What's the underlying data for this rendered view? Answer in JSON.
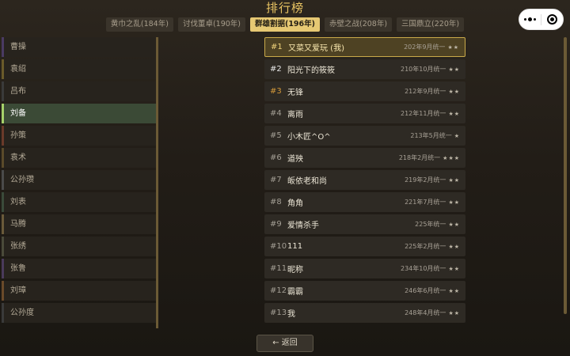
{
  "title": "排行榜",
  "tabs": [
    {
      "label": "黄巾之乱(184年)"
    },
    {
      "label": "讨伐董卓(190年)"
    },
    {
      "label": "群雄割据(196年)",
      "active": true
    },
    {
      "label": "赤壁之战(208年)"
    },
    {
      "label": "三国鼎立(220年)"
    }
  ],
  "sidebar": {
    "items": [
      {
        "label": "曹操",
        "accent": "#4a3a62"
      },
      {
        "label": "袁绍",
        "accent": "#6a5a2a"
      },
      {
        "label": "吕布",
        "accent": "#3a3a3a"
      },
      {
        "label": "刘备",
        "accent": "#a6d16a",
        "active": true
      },
      {
        "label": "孙策",
        "accent": "#6a3a2a"
      },
      {
        "label": "袁术",
        "accent": "#5a4a2a"
      },
      {
        "label": "公孙瓒",
        "accent": "#4a4a4a"
      },
      {
        "label": "刘表",
        "accent": "#3a4a3a"
      },
      {
        "label": "马腾",
        "accent": "#6a5a3a"
      },
      {
        "label": "张绣",
        "accent": "#4a4a3a"
      },
      {
        "label": "张鲁",
        "accent": "#4a3a5a"
      },
      {
        "label": "刘璋",
        "accent": "#6a4a2a"
      },
      {
        "label": "公孙度",
        "accent": "#3a3a3a"
      }
    ]
  },
  "ranking": [
    {
      "rank": "#1",
      "name": "又菜又爱玩 (我)",
      "date": "202年9月统一",
      "stars": "★★",
      "me": true,
      "medal": "gold"
    },
    {
      "rank": "#2",
      "name": "阳光下的筱筱",
      "date": "210年10月统一",
      "stars": "★★",
      "medal": "silver"
    },
    {
      "rank": "#3",
      "name": "无锋",
      "date": "212年9月统一",
      "stars": "★★",
      "medal": "bronze"
    },
    {
      "rank": "#4",
      "name": "离雨",
      "date": "212年11月统一",
      "stars": "★★"
    },
    {
      "rank": "#5",
      "name": "小木匠^O^",
      "date": "213年5月统一",
      "stars": "★"
    },
    {
      "rank": "#6",
      "name": "道殃",
      "date": "218年2月统一",
      "stars": "★★★"
    },
    {
      "rank": "#7",
      "name": "皈依老和尚",
      "date": "219年2月统一",
      "stars": "★★"
    },
    {
      "rank": "#8",
      "name": "角角",
      "date": "221年7月统一",
      "stars": "★★"
    },
    {
      "rank": "#9",
      "name": "爱情杀手",
      "date": "225年统一",
      "stars": "★★"
    },
    {
      "rank": "#10",
      "name": "111",
      "date": "225年2月统一",
      "stars": "★★"
    },
    {
      "rank": "#11",
      "name": "昵称",
      "date": "234年10月统一",
      "stars": "★★"
    },
    {
      "rank": "#12",
      "name": "霸霸",
      "date": "246年6月统一",
      "stars": "★★"
    },
    {
      "rank": "#13",
      "name": "我",
      "date": "248年4月统一",
      "stars": "★★"
    }
  ],
  "back_button": {
    "label": "← 返回"
  },
  "capsule": {
    "menu_icon": "more-dots-icon",
    "close_icon": "target-close-icon"
  },
  "colors": {
    "accent": "#e6c873",
    "background": "#221d17",
    "active_side": "#a6d16a"
  }
}
